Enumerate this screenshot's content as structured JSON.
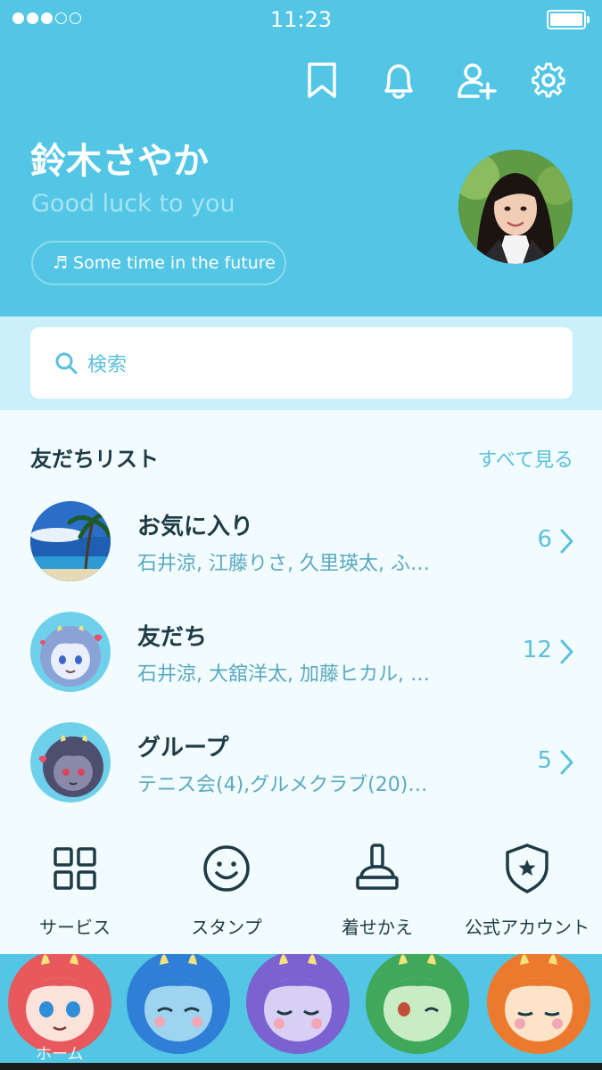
{
  "status_bar": {
    "time": "11:23"
  },
  "header": {
    "icons": [
      "bookmark-icon",
      "bell-icon",
      "add-friend-icon",
      "gear-icon"
    ],
    "name": "鈴木さやか",
    "status_message": "Good luck to you",
    "music": "Some time in the future"
  },
  "search": {
    "placeholder": "検索"
  },
  "friends": {
    "title": "友だちリスト",
    "see_all": "すべて見る",
    "rows": [
      {
        "title": "お気に入り",
        "members": "石井涼, 江藤りさ, 久里瑛太, ふ…",
        "count": "6"
      },
      {
        "title": "友だち",
        "members": "石井涼, 大舘洋太, 加藤ヒカル, …",
        "count": "12"
      },
      {
        "title": "グループ",
        "members": "テニス会(4),グルメクラブ(20)…",
        "count": "5"
      }
    ]
  },
  "services": [
    {
      "label": "サービス",
      "icon": "grid-icon"
    },
    {
      "label": "スタンプ",
      "icon": "smiley-icon"
    },
    {
      "label": "着せかえ",
      "icon": "brush-icon"
    },
    {
      "label": "公式アカウント",
      "icon": "shield-star-icon"
    }
  ],
  "tabbar": {
    "home_label": "ホーム"
  },
  "colors": {
    "accent": "#52c6e4",
    "text_dark": "#1f3b46",
    "text_link": "#5bc0da"
  }
}
